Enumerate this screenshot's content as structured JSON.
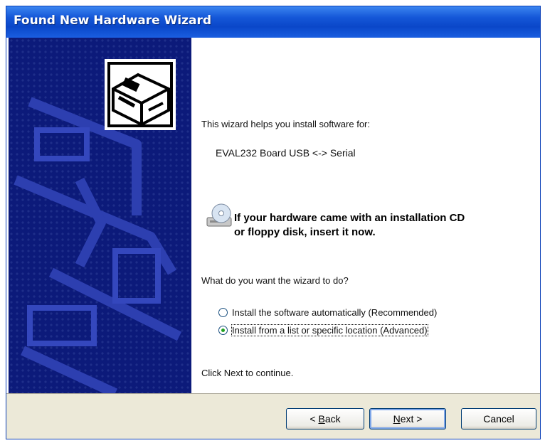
{
  "window": {
    "title": "Found New Hardware Wizard"
  },
  "content": {
    "intro": "This wizard helps you install software for:",
    "device_name": "EVAL232 Board USB <-> Serial",
    "cd_notice_line1": "If your hardware came with an installation CD",
    "cd_notice_line2": "or floppy disk, insert it now.",
    "question": "What do you want the wizard to do?",
    "options": [
      {
        "label": "Install the software automatically (Recommended)",
        "selected": false
      },
      {
        "label": "Install from a list or specific location (Advanced)",
        "selected": true
      }
    ],
    "continue_hint": "Click Next to continue."
  },
  "buttons": {
    "back_prefix": "< ",
    "back_accel": "B",
    "back_rest": "ack",
    "next_accel": "N",
    "next_rest": "ext >",
    "cancel": "Cancel"
  },
  "icons": {
    "hardware": "hardware-install-icon",
    "cd": "cd-drive-icon"
  },
  "colors": {
    "titlebar": "#0a47c9",
    "banner": "#0c1a7a",
    "footer": "#ece9d8"
  }
}
